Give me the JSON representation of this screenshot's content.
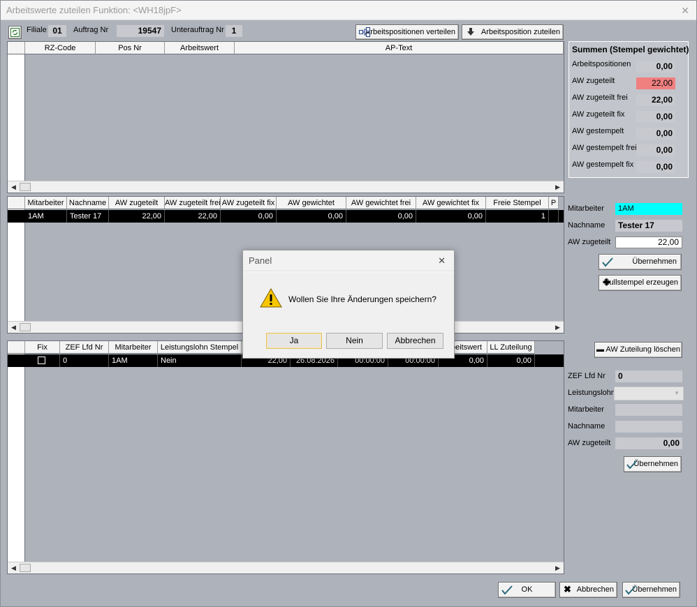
{
  "window": {
    "title": "Arbeitswerte zuteilen Funktion: <WH18jpF>",
    "close_glyph": "✕"
  },
  "header": {
    "filiale_label": "Filiale",
    "filiale_value": "01",
    "auftrag_label": "Auftrag Nr",
    "auftrag_value": "19547",
    "unterauftrag_label": "Unterauftrag Nr",
    "unterauftrag_value": "1",
    "btn_verteilen": "Arbeitspositionen verteilen",
    "btn_zuteilen": "Arbeitsposition zuteilen"
  },
  "grid1": {
    "columns": [
      "RZ-Code",
      "Pos Nr",
      "Arbeitswert",
      "AP-Text"
    ]
  },
  "summen": {
    "title": "Summen (Stempel gewichtet)",
    "rows": [
      {
        "label": "Arbeitspositionen",
        "value": "0,00"
      },
      {
        "label": "AW zugeteilt",
        "value": "22,00"
      },
      {
        "label": "AW zugeteilt frei",
        "value": "22,00"
      },
      {
        "label": "AW zugeteilt fix",
        "value": "0,00"
      },
      {
        "label": "AW gestempelt",
        "value": "0,00"
      },
      {
        "label": "AW gestempelt frei",
        "value": "0,00"
      },
      {
        "label": "AW gestempelt fix",
        "value": "0,00"
      }
    ],
    "highlight_color": "#f08080"
  },
  "grid2": {
    "columns": [
      "Mitarbeiter",
      "Nachname",
      "AW zugeteilt",
      "AW zugeteilt frei",
      "AW zugeteilt fix",
      "AW gewichtet",
      "AW gewichtet frei",
      "AW gewichtet fix",
      "Freie Stempel",
      "P"
    ],
    "row": [
      "1AM",
      "Tester 17",
      "22,00",
      "22,00",
      "0,00",
      "0,00",
      "0,00",
      "0,00",
      "1",
      ""
    ]
  },
  "edit1": {
    "mitarbeiter_label": "Mitarbeiter",
    "mitarbeiter_value": "1AM",
    "nachname_label": "Nachname",
    "nachname_value": "Tester 17",
    "aw_label": "AW zugeteilt",
    "aw_value": "22,00",
    "btn_uebernehmen": "Übernehmen",
    "btn_nullstempel": "Nullstempel erzeugen",
    "mitarbeiter_color": "#00ffff"
  },
  "grid3": {
    "columns": [
      "Fix",
      "ZEF Lfd Nr",
      "Mitarbeiter",
      "Leistungslohn Stempel",
      "",
      "",
      "",
      "",
      "Arbeitswert",
      "LL Zuteilung"
    ],
    "row": [
      "",
      "0",
      "1AM",
      "Nein",
      "22,00",
      "26.08.2026",
      "00:00:00",
      "00:00:00",
      "0,00",
      "0,00"
    ]
  },
  "edit2": {
    "btn_loeschen": "AW Zuteilung löschen",
    "zef_label": "ZEF Lfd Nr",
    "zef_value": "0",
    "leistungslohn_label": "Leistungslohn",
    "mitarbeiter_label": "Mitarbeiter",
    "nachname_label": "Nachname",
    "aw_label": "AW zugeteilt",
    "aw_value": "0,00",
    "btn_uebernehmen": "Übernehmen"
  },
  "footer": {
    "ok": "OK",
    "abbrechen": "Abbrechen",
    "uebernehmen": "Übernehmen"
  },
  "dialog": {
    "title": "Panel",
    "close_glyph": "✕",
    "message": "Wollen Sie Ihre Änderungen speichern?",
    "ja": "Ja",
    "nein": "Nein",
    "abbrechen": "Abbrechen"
  }
}
